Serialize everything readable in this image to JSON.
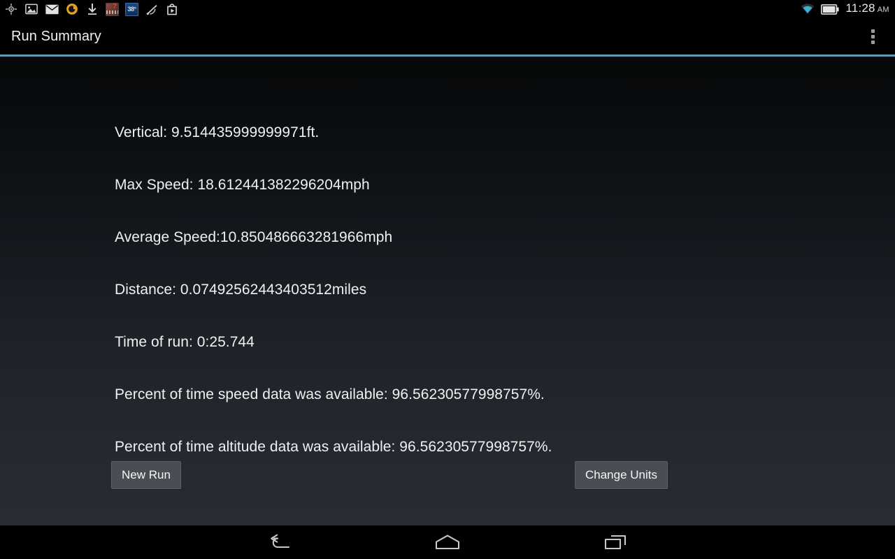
{
  "status_bar": {
    "left_icons": [
      {
        "name": "gps-location-icon",
        "label": "GPS location"
      },
      {
        "name": "screenshot-image-icon",
        "label": "Screenshot captured"
      },
      {
        "name": "email-icon",
        "label": "New email"
      },
      {
        "name": "app-update-icon",
        "label": "App notification"
      },
      {
        "name": "download-icon",
        "label": "Download complete"
      },
      {
        "name": "news-icon",
        "label": "News"
      },
      {
        "name": "weather-icon",
        "label": "38°"
      },
      {
        "name": "network-signal-icon",
        "label": "Network activity"
      },
      {
        "name": "play-store-icon",
        "label": "Play Store"
      }
    ],
    "weather_temp": "38°",
    "wifi": "wifi-icon",
    "battery": "battery-icon",
    "time": "11:28",
    "meridiem": "AM"
  },
  "action_bar": {
    "title": "Run Summary",
    "overflow_menu": "⋮"
  },
  "main": {
    "stats": [
      "Vertical: 9.514435999999971ft.",
      "Max Speed: 18.612441382296204mph",
      "Average Speed:10.850486663281966mph",
      "Distance: 0.07492562443403512miles",
      "Time of run: 0:25.744",
      "Percent of time speed data was available: 96.56230577998757%.",
      "Percent of time altitude data was available: 96.56230577998757%."
    ],
    "buttons": {
      "new_run": "New Run",
      "change_units": "Change Units"
    }
  },
  "nav_bar": {
    "back": "back-icon",
    "home": "home-icon",
    "recents": "recents-icon"
  },
  "colors": {
    "accent_divider": "#5d9cb8",
    "wifi": "#39b4cf",
    "button_face": "#4a4e54",
    "text": "#f0f0f0",
    "background_top": "#060809",
    "background_bottom": "#282c34"
  }
}
